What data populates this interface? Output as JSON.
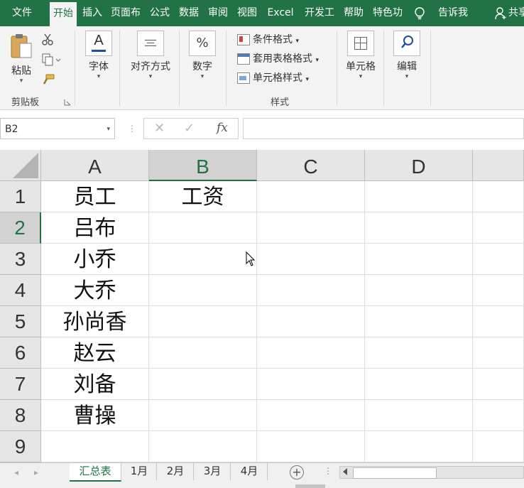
{
  "menu": {
    "tabs": [
      "文件",
      "开始",
      "插入",
      "页面布",
      "公式",
      "数据",
      "审阅",
      "视图",
      "Excel",
      "开发工",
      "帮助",
      "特色功"
    ],
    "active_tab": "开始",
    "tell_me": "告诉我",
    "share": "共享",
    "accent_color": "#217346"
  },
  "ribbon": {
    "paste_label": "粘贴",
    "clipboard_group": "剪贴板",
    "font_label": "字体",
    "align_label": "对齐方式",
    "number_label": "数字",
    "number_icon": "%",
    "cond_format": "条件格式",
    "table_format": "套用表格格式",
    "cell_style": "单元格样式",
    "styles_group": "样式",
    "cells_label": "单元格",
    "edit_label": "编辑"
  },
  "formula_bar": {
    "name_box": "B2",
    "formula": "",
    "fx": "fx"
  },
  "grid": {
    "columns": [
      "A",
      "B",
      "C",
      "D"
    ],
    "rows": [
      "1",
      "2",
      "3",
      "4",
      "5",
      "6",
      "7",
      "8",
      "9"
    ],
    "selected_cell": "B2",
    "cells": {
      "A1": "员工",
      "B1": "工资",
      "A2": "吕布",
      "A3": "小乔",
      "A4": "大乔",
      "A5": "孙尚香",
      "A6": "赵云",
      "A7": "刘备",
      "A8": "曹操"
    }
  },
  "sheets": {
    "tabs": [
      "汇总表",
      "1月",
      "2月",
      "3月",
      "4月"
    ],
    "active": "汇总表"
  }
}
